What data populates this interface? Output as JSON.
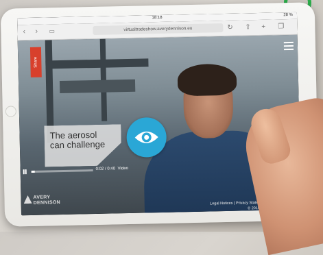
{
  "status_bar": {
    "time": "18:18",
    "battery": "28 %"
  },
  "browser": {
    "url": "virtualtradeshow.averydennison.eu"
  },
  "video": {
    "share_label": "Share",
    "caption": "The aerosol can challenge",
    "time_readout": "0:02 / 0:40",
    "video_label": "Video",
    "progress": 0.05
  },
  "brand": {
    "name_line1": "AVERY",
    "name_line2": "DENNISON"
  },
  "footer": {
    "links": "Legal Notices | Privacy Statement | Disclaimer",
    "copyright": "© 2015 Avery Dennison"
  },
  "colors": {
    "eye_button": "#2aa7d6",
    "share_tab": "#d8402c"
  }
}
